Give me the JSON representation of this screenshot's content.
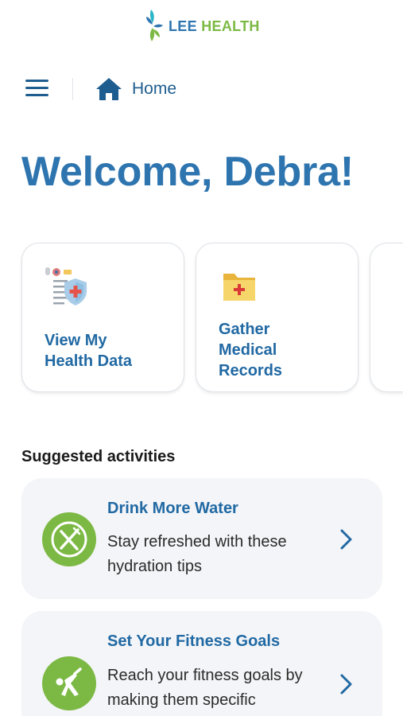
{
  "header": {
    "logo_word1": "LEE",
    "logo_word2": "HEALTH",
    "brand_blue": "#2e75b0",
    "brand_green": "#7cb944"
  },
  "nav": {
    "menu_icon": "hamburger-menu-icon",
    "home_icon": "home-icon",
    "home_label": "Home"
  },
  "welcome": {
    "text": "Welcome, Debra!"
  },
  "quick_actions": [
    {
      "label": "View My\nHealth Data",
      "icon": "health-record-shield-icon"
    },
    {
      "label": "Gather\nMedical\nRecords",
      "icon": "medical-folder-icon"
    }
  ],
  "suggested": {
    "title": "Suggested activities",
    "items": [
      {
        "title": "Drink More Water",
        "description": "Stay refreshed with these hydration tips",
        "icon": "fork-knife-icon",
        "icon_color": "#7cb944"
      },
      {
        "title": "Set Your Fitness Goals",
        "description": "Reach your fitness goals by making them specific",
        "icon": "stretching-person-icon",
        "icon_color": "#7cb944"
      }
    ]
  }
}
